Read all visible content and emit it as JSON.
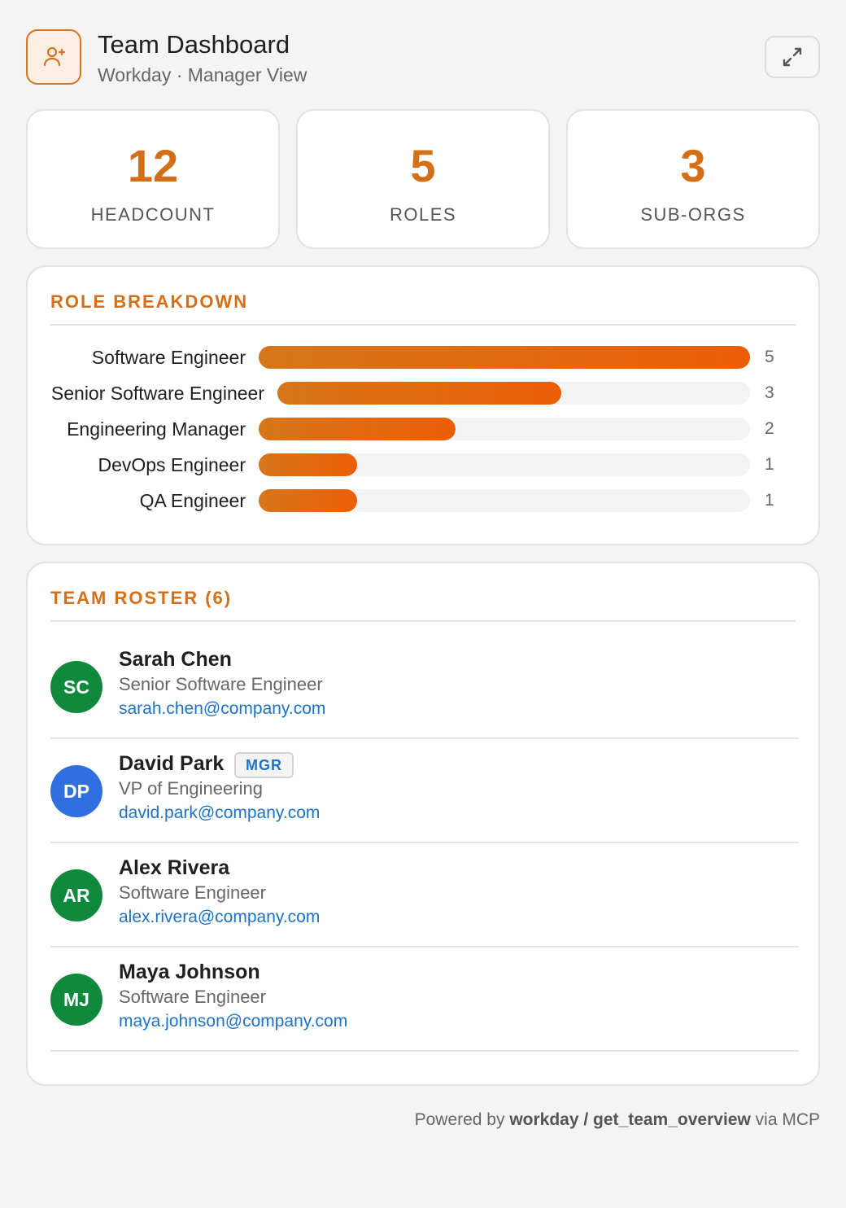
{
  "header": {
    "title": "Team Dashboard",
    "subtitle": "Workday · Manager View",
    "app_icon": "person-plus-icon",
    "expand_icon": "expand-icon"
  },
  "stats": [
    {
      "value": "12",
      "label": "HEADCOUNT"
    },
    {
      "value": "5",
      "label": "ROLES"
    },
    {
      "value": "3",
      "label": "SUB-ORGS"
    }
  ],
  "role_breakdown": {
    "title": "ROLE BREAKDOWN",
    "max": 5,
    "roles": [
      {
        "label": "Software Engineer",
        "count": 5
      },
      {
        "label": "Senior Software Engineer",
        "count": 3
      },
      {
        "label": "Engineering Manager",
        "count": 2
      },
      {
        "label": "DevOps Engineer",
        "count": 1
      },
      {
        "label": "QA Engineer",
        "count": 1
      }
    ]
  },
  "roster": {
    "title": "TEAM ROSTER (6)",
    "members": [
      {
        "initials": "SC",
        "name": "Sarah Chen",
        "role": "Senior Software Engineer",
        "email": "sarah.chen@company.com",
        "avatar_color": "#0f8a3c",
        "badge": ""
      },
      {
        "initials": "DP",
        "name": "David Park",
        "role": "VP of Engineering",
        "email": "david.park@company.com",
        "avatar_color": "#2f6fe0",
        "badge": "MGR"
      },
      {
        "initials": "AR",
        "name": "Alex Rivera",
        "role": "Software Engineer",
        "email": "alex.rivera@company.com",
        "avatar_color": "#0f8a3c",
        "badge": ""
      },
      {
        "initials": "MJ",
        "name": "Maya Johnson",
        "role": "Software Engineer",
        "email": "maya.johnson@company.com",
        "avatar_color": "#0f8a3c",
        "badge": ""
      }
    ]
  },
  "footer": {
    "prefix": "Powered by ",
    "source": "workday / get_team_overview",
    "suffix": " via MCP"
  },
  "colors": {
    "accent": "#d46f18",
    "link": "#1a73c8"
  }
}
